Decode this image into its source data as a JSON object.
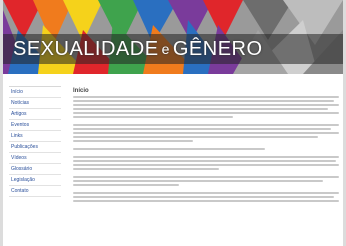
{
  "banner": {
    "title_main": "SEXUALIDADE",
    "title_conj": "e",
    "title_end": "GÊNERO"
  },
  "sidebar": {
    "items": [
      {
        "label": "Início"
      },
      {
        "label": "Notícias"
      },
      {
        "label": "Artigos"
      },
      {
        "label": "Eventos"
      },
      {
        "label": "Links"
      },
      {
        "label": "Publicações"
      },
      {
        "label": "Vídeos"
      },
      {
        "label": "Glossário"
      },
      {
        "label": "Legislação"
      },
      {
        "label": "Contato"
      }
    ]
  },
  "content": {
    "title": "Início"
  },
  "colors": {
    "background": "#dcdcdc",
    "page": "#ffffff",
    "link": "#2a4f9a",
    "rainbow": [
      "#e0262b",
      "#f07b1d",
      "#f5d21b",
      "#3fa34d",
      "#2a6fc0",
      "#7a3b9b"
    ]
  }
}
